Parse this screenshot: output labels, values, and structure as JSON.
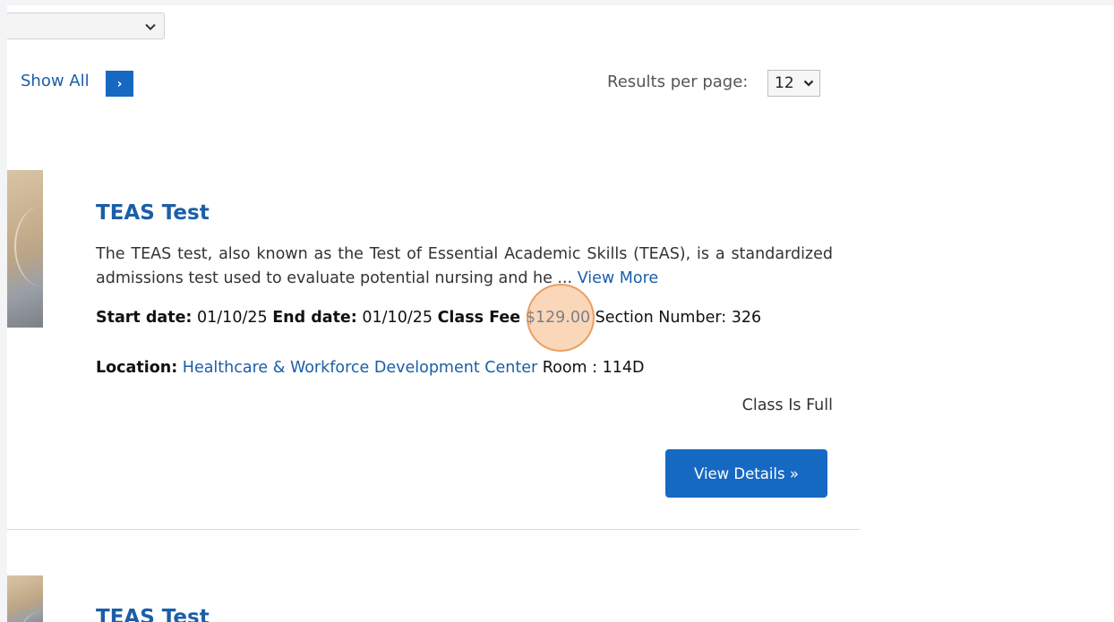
{
  "controls": {
    "show_all_label": "Show All",
    "show_all_arrow": "›",
    "results_per_page_label": "Results per page:",
    "results_per_page_value": "12"
  },
  "courses": [
    {
      "title": "TEAS Test",
      "description": "The TEAS test, also known as the Test of Essential Academic Skills (TEAS), is a standardized admissions test used to evaluate potential nursing and he ...",
      "view_more": "View More",
      "start_date_label": "Start date:",
      "start_date": "01/10/25",
      "end_date_label": "End date:",
      "end_date": "01/10/25",
      "fee_label": "Class Fee",
      "fee": "$129.00",
      "section_label": "Section Number:",
      "section": "326",
      "location_label": "Location:",
      "location": "Healthcare & Workforce Development Center",
      "room_label": "Room :",
      "room": "114D",
      "status": "Class Is Full",
      "details_button": "View Details »"
    },
    {
      "title": "TEAS Test"
    }
  ],
  "colors": {
    "link": "#1b5ea8",
    "button": "#1669c2",
    "click_marker": "#f5a664"
  }
}
